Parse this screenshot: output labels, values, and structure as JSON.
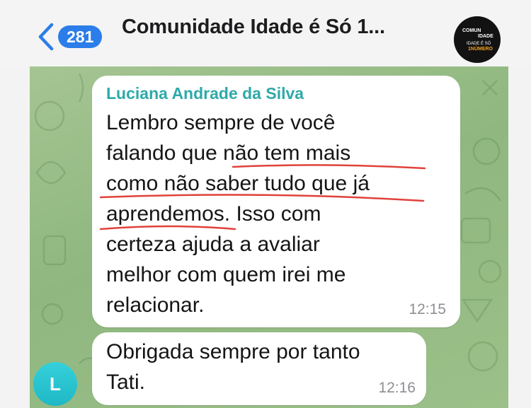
{
  "header": {
    "back_count": "281",
    "title": "Comunidade Idade é Só 1...",
    "group_avatar_text": [
      "COMUN",
      "IDADE",
      "IDADE É SÓ",
      "1NÚMERO"
    ]
  },
  "messages": [
    {
      "sender": "Luciana Andrade da Silva",
      "text": "Lembro sempre de você\nfalando que não tem mais\ncomo não saber tudo que já\naprendemos. Isso com\ncerteza ajuda a avaliar\nmelhor com quem irei me\nrelacionar.",
      "time": "12:15"
    },
    {
      "text": "Obrigada sempre por tanto\nTati.",
      "time": "12:16"
    }
  ],
  "user_avatar_initial": "L",
  "colors": {
    "accent": "#2b7de9",
    "sender_name": "#2fa9a9",
    "underline_marks": "#e0423b",
    "chat_background": "#9cc089"
  }
}
